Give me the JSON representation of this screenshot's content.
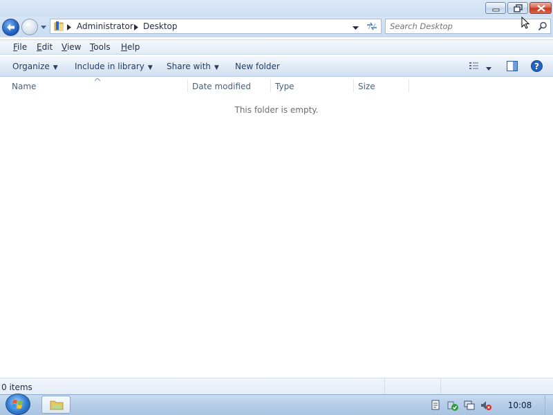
{
  "window": {
    "caption_buttons": [
      "minimize-icon",
      "restore-icon",
      "close-icon"
    ]
  },
  "navigation": {
    "back_icon": "back-arrow-icon",
    "forward_icon": "forward-arrow-icon",
    "breadcrumb": [
      "Administrator",
      "Desktop"
    ],
    "refresh_icon": "refresh-icon",
    "search_placeholder": "Search Desktop",
    "search_value": ""
  },
  "menu": {
    "items": [
      {
        "label": "File",
        "accel": "F"
      },
      {
        "label": "Edit",
        "accel": "E"
      },
      {
        "label": "View",
        "accel": "V"
      },
      {
        "label": "Tools",
        "accel": "T"
      },
      {
        "label": "Help",
        "accel": "H"
      }
    ]
  },
  "commands": {
    "organize": "Organize",
    "include_in_library": "Include in library",
    "share_with": "Share with",
    "new_folder": "New folder"
  },
  "columns": [
    "Name",
    "Date modified",
    "Type",
    "Size"
  ],
  "content": {
    "empty_message": "This folder is empty."
  },
  "status": {
    "items_text": "0 items"
  },
  "taskbar": {
    "clock": "10:08"
  },
  "colors": {
    "accent": "#2061c4",
    "chrome": "#cfe0f3",
    "close_button": "#c8381d"
  }
}
